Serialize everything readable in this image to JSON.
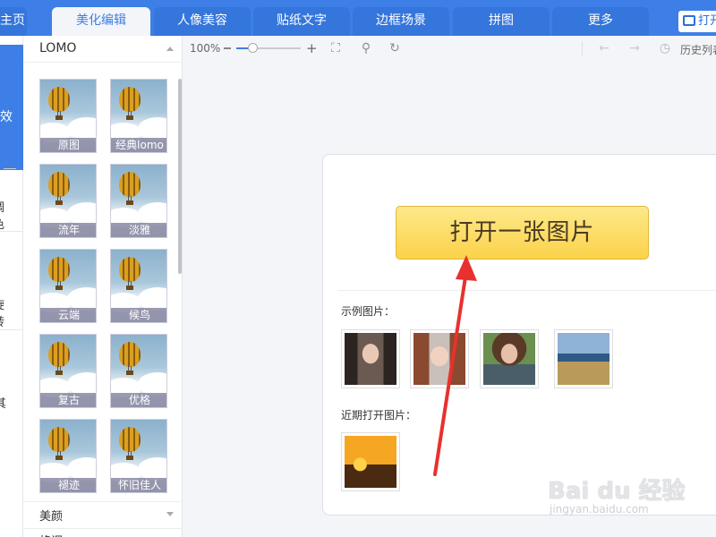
{
  "tabs": [
    {
      "label": "主页"
    },
    {
      "label": "美化编辑"
    },
    {
      "label": "人像美容"
    },
    {
      "label": "贴纸文字"
    },
    {
      "label": "边框场景"
    },
    {
      "label": "拼图"
    },
    {
      "label": "更多"
    }
  ],
  "open_button": {
    "label": "打开"
  },
  "leftnav": {
    "active_label": "效",
    "items": [
      {
        "label": "调色"
      },
      {
        "label": "旋转"
      },
      {
        "label": "其"
      }
    ]
  },
  "panel": {
    "title": "LOMO",
    "thumbnails": [
      {
        "label": "原图"
      },
      {
        "label": "经典lomo"
      },
      {
        "label": "流年"
      },
      {
        "label": "淡雅"
      },
      {
        "label": "云端"
      },
      {
        "label": "候鸟"
      },
      {
        "label": "复古"
      },
      {
        "label": "优格"
      },
      {
        "label": "褪迹"
      },
      {
        "label": "怀旧佳人"
      }
    ],
    "section_beauty": "美颜",
    "section_next": "格调"
  },
  "toolbar": {
    "zoom": "100%",
    "history_label": "历史列表"
  },
  "card": {
    "open_label": "打开一张图片",
    "sample_label": "示例图片：",
    "recent_label": "近期打开图片："
  },
  "watermark": {
    "main": "Bai du 经验",
    "sub": "jingyan.baidu.com"
  },
  "colors": {
    "accent": "#3d7fe6",
    "open_button_top": "#fde98a",
    "open_button_bottom": "#fbd24a",
    "arrow": "#e8312f"
  }
}
